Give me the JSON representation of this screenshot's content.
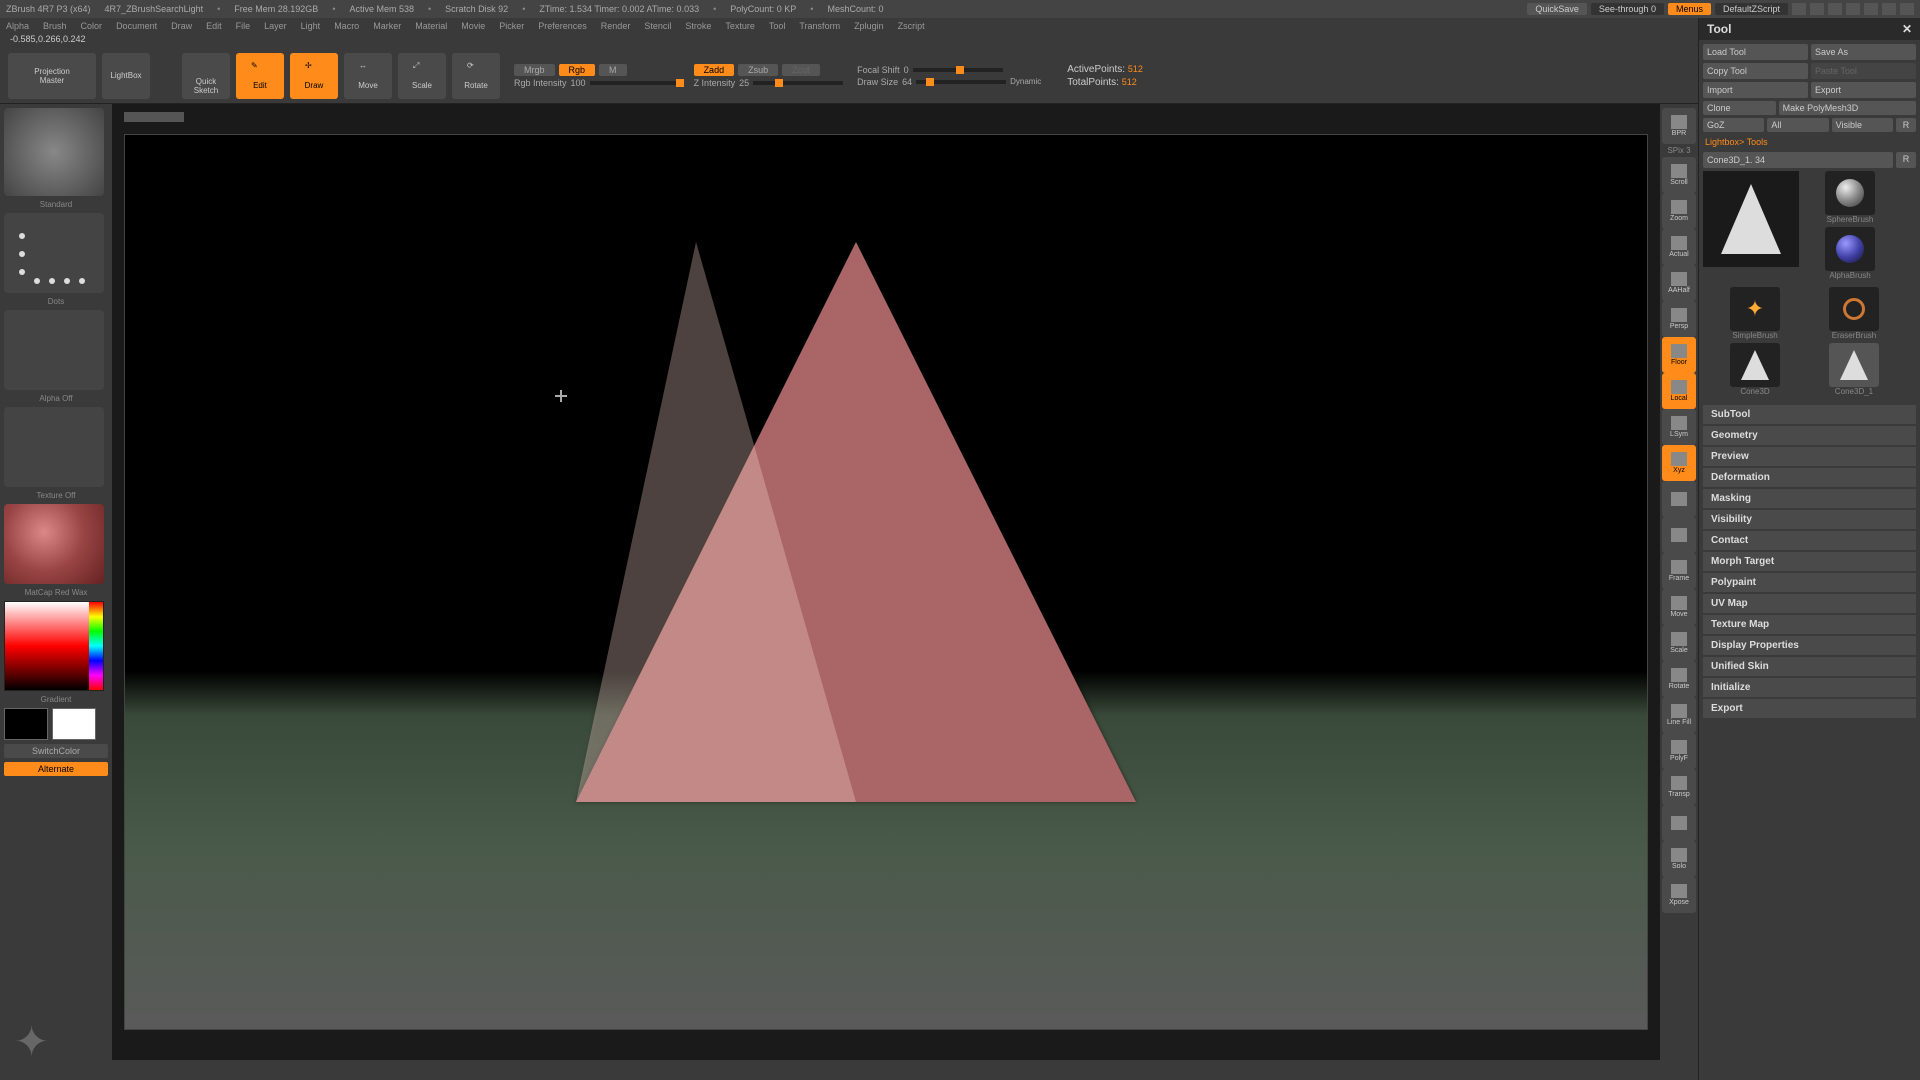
{
  "titlebar": {
    "app": "ZBrush 4R7 P3 (x64)",
    "doc": "4R7_ZBrushSearchLight",
    "stats": [
      "Free Mem 28.192GB",
      "Active Mem 538",
      "Scratch Disk 92",
      "ZTime: 1.534 Timer: 0.002 ATime: 0.033",
      "PolyCount: 0 KP",
      "MeshCount: 0"
    ],
    "quicksave": "QuickSave",
    "seethrough": "See-through  0",
    "menus": "Menus",
    "script": "DefaultZScript"
  },
  "menubar": [
    "Alpha",
    "Brush",
    "Color",
    "Document",
    "Draw",
    "Edit",
    "File",
    "Layer",
    "Light",
    "Macro",
    "Marker",
    "Material",
    "Movie",
    "Picker",
    "Preferences",
    "Render",
    "Stencil",
    "Stroke",
    "Texture",
    "Tool",
    "Transform",
    "Zplugin",
    "Zscript"
  ],
  "coords": "-0.585,0.266,0.242",
  "shelf": {
    "projection": "Projection\nMaster",
    "lightbox": "LightBox",
    "quicksketch": "Quick\nSketch",
    "modes": [
      "Edit",
      "Draw",
      "Move",
      "Scale",
      "Rotate"
    ],
    "mrgb": "Mrgb",
    "rgb": "Rgb",
    "m": "M",
    "rgb_intensity_label": "Rgb Intensity",
    "rgb_intensity": "100",
    "zadd": "Zadd",
    "zsub": "Zsub",
    "zcut": "Zcut",
    "z_intensity_label": "Z Intensity",
    "z_intensity": "25",
    "focal_label": "Focal Shift",
    "focal": "0",
    "draw_size_label": "Draw Size",
    "draw_size": "64",
    "dynamic": "Dynamic",
    "active_label": "ActivePoints:",
    "active": "512",
    "total_label": "TotalPoints:",
    "total": "512"
  },
  "left": {
    "brush": "Standard",
    "stroke": "Dots",
    "alpha": "Alpha Off",
    "texture": "Texture Off",
    "material": "MatCap Red Wax",
    "gradient": "Gradient",
    "switchcolor": "SwitchColor",
    "alternate": "Alternate"
  },
  "rightstrip": {
    "bpr": "BPR",
    "spix": "SPix 3",
    "items": [
      "Scroll",
      "Zoom",
      "Actual",
      "AAHalf",
      "Persp",
      "Floor",
      "Local",
      "LSym",
      "Xyz",
      "",
      "",
      "Frame",
      "Move",
      "Scale",
      "Rotate",
      "Line Fill",
      "PolyF",
      "Transp",
      "",
      "Solo",
      "Xpose"
    ],
    "active_items": [
      "Floor",
      "Local",
      "Xyz"
    ]
  },
  "tool": {
    "title": "Tool",
    "load": "Load Tool",
    "save": "Save As",
    "copy": "Copy Tool",
    "paste": "Paste Tool",
    "import": "Import",
    "export": "Export",
    "clone": "Clone",
    "polymesh": "Make PolyMesh3D",
    "goz": "GoZ",
    "all": "All",
    "visible": "Visible",
    "r1": "R",
    "crumb": "Lightbox> Tools",
    "current": "Cone3D_1. 34",
    "r2": "R",
    "thumbs": [
      "Cone3D_1",
      "SphereBrush",
      "AlphaBrush",
      "SimpleBrush",
      "EraserBrush",
      "Cone3D",
      "Cone3D_1"
    ],
    "sections": [
      "SubTool",
      "Geometry",
      "Preview",
      "Deformation",
      "Masking",
      "Visibility",
      "Contact",
      "Morph Target",
      "Polypaint",
      "UV Map",
      "Texture Map",
      "Display Properties",
      "Unified Skin",
      "Initialize",
      "Export"
    ]
  }
}
